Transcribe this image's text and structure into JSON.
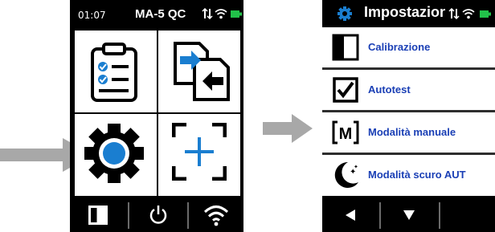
{
  "screen1": {
    "status": {
      "time": "01:07",
      "device": "MA-5 QC"
    },
    "tiles": [
      {
        "icon": "clipboard-checklist-icon"
      },
      {
        "icon": "data-transfer-icon"
      },
      {
        "icon": "settings-gear-icon"
      },
      {
        "icon": "measure-target-icon"
      }
    ],
    "bottom_bar": [
      {
        "icon": "calibration-tile-icon"
      },
      {
        "icon": "power-icon"
      },
      {
        "icon": "wifi-icon"
      }
    ]
  },
  "screen2": {
    "title": "Impostazioni",
    "menu": [
      {
        "label": "Calibrazione",
        "icon": "calibration-tile-icon"
      },
      {
        "label": "Autotest",
        "icon": "checkbox-icon"
      },
      {
        "label": "Modalità manuale",
        "icon": "manual-mode-icon"
      },
      {
        "label": "Modalità scuro AUT",
        "icon": "dark-mode-moon-icon"
      }
    ],
    "bottom_bar": [
      {
        "icon": "left-arrow-icon"
      },
      {
        "icon": "down-arrow-icon"
      }
    ]
  },
  "colors": {
    "accent_blue": "#1a7ed0",
    "label_blue": "#1a3fb5",
    "arrow_gray": "#a8a8a8",
    "battery_green": "#22c24a"
  }
}
